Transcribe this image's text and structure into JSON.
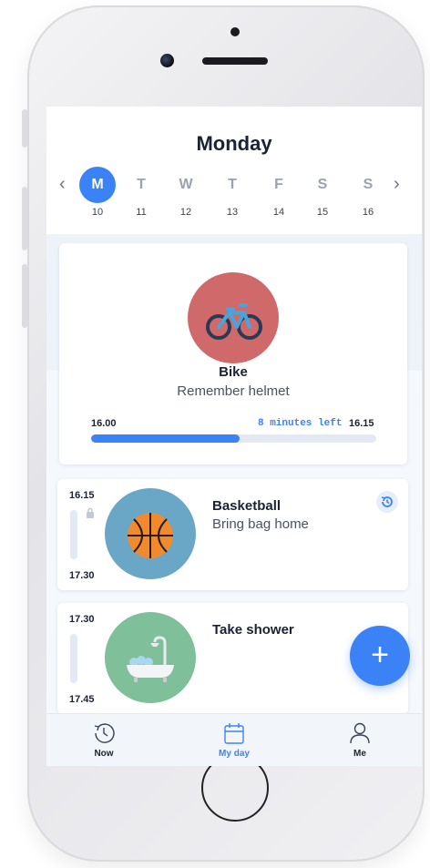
{
  "calendar": {
    "day_title": "Monday",
    "prev_icon": "chevron-left-icon",
    "next_icon": "chevron-right-icon",
    "days": [
      {
        "letter": "M",
        "date": "10",
        "selected": true
      },
      {
        "letter": "T",
        "date": "11",
        "selected": false
      },
      {
        "letter": "W",
        "date": "12",
        "selected": false
      },
      {
        "letter": "T",
        "date": "13",
        "selected": false
      },
      {
        "letter": "F",
        "date": "14",
        "selected": false
      },
      {
        "letter": "S",
        "date": "15",
        "selected": false
      },
      {
        "letter": "S",
        "date": "16",
        "selected": false
      }
    ]
  },
  "current_activity": {
    "title": "Bike",
    "note": "Remember helmet",
    "start": "16.00",
    "end": "16.15",
    "time_left": "8 minutes left",
    "progress_percent": 52,
    "icon": "bicycle-icon",
    "color": "#d06a6a"
  },
  "activities": [
    {
      "title": "Basketball",
      "note": "Bring bag home",
      "start": "16.15",
      "end": "17.30",
      "icon": "basketball-icon",
      "color": "#6aa6c6",
      "has_history": true,
      "locked": true
    },
    {
      "title": "Take shower",
      "note": "",
      "start": "17.30",
      "end": "17.45",
      "icon": "bathtub-icon",
      "color": "#7fbf9a",
      "has_history": false,
      "locked": false
    }
  ],
  "fab": {
    "icon": "plus-icon",
    "label": "+"
  },
  "tabs": [
    {
      "label": "Now",
      "icon": "clock-history-icon",
      "active": false
    },
    {
      "label": "My day",
      "icon": "calendar-icon",
      "active": true
    },
    {
      "label": "Me",
      "icon": "person-icon",
      "active": false
    }
  ],
  "colors": {
    "accent": "#3b82f6",
    "text": "#1a2233"
  }
}
